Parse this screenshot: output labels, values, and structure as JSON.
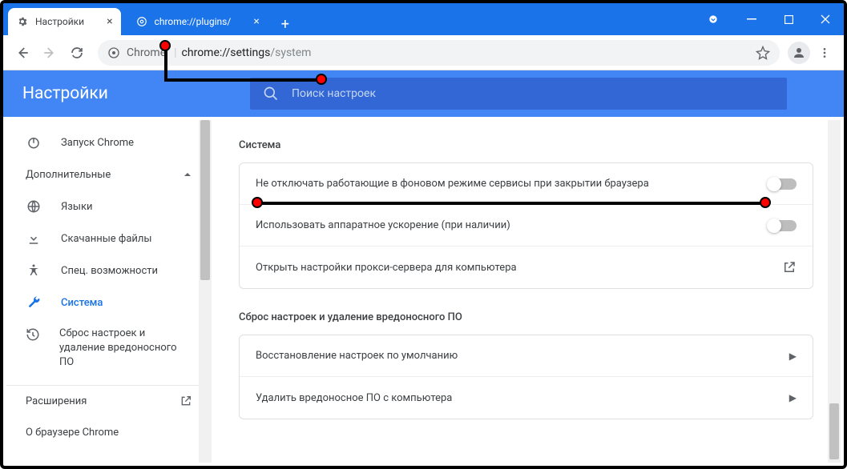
{
  "tabs": [
    {
      "label": "Настройки"
    },
    {
      "label": "chrome://plugins/"
    }
  ],
  "omnibox": {
    "chip": "Chrome",
    "url_prefix": "chrome://settings",
    "url_suffix": "/system"
  },
  "header": {
    "title": "Настройки"
  },
  "search": {
    "placeholder": "Поиск настроек"
  },
  "sidebar": {
    "startup": "Запуск Chrome",
    "advanced_header": "Дополнительные",
    "languages": "Языки",
    "downloads": "Скачанные файлы",
    "accessibility": "Спец. возможности",
    "system": "Система",
    "reset": "Сброс настроек и удаление вредоносного ПО",
    "extensions": "Расширения",
    "about": "О браузере Chrome"
  },
  "content": {
    "section_system": "Система",
    "row_background": "Не отключать работающие в фоновом режиме сервисы при закрытии браузера",
    "row_hardware": "Использовать аппаратное ускорение (при наличии)",
    "row_proxy": "Открыть настройки прокси-сервера для компьютера",
    "section_reset": "Сброс настроек и удаление вредоносного ПО",
    "row_restore": "Восстановление настроек по умолчанию",
    "row_cleanup": "Удалить вредоносное ПО с компьютера"
  }
}
